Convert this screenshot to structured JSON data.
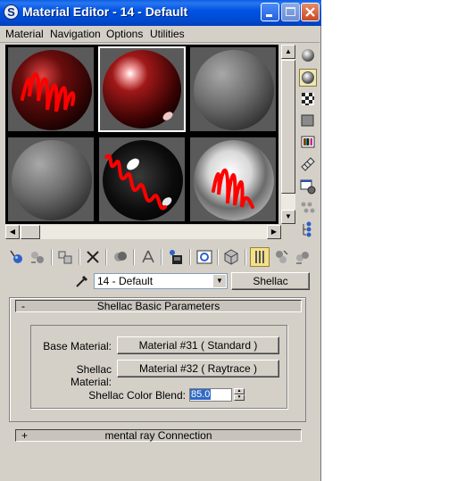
{
  "window": {
    "title": "Material Editor - 14 - Default",
    "app_icon": "3ds-max-icon"
  },
  "menubar": [
    "Material",
    "Navigation",
    "Options",
    "Utilities"
  ],
  "sample_slots": [
    {
      "label": "slot-1",
      "sphere": "dark-red",
      "scribble": true,
      "active": false
    },
    {
      "label": "slot-2",
      "sphere": "red-glossy",
      "scribble": false,
      "active": true
    },
    {
      "label": "slot-3",
      "sphere": "gray",
      "scribble": false,
      "active": false
    },
    {
      "label": "slot-4",
      "sphere": "gray",
      "scribble": false,
      "active": false
    },
    {
      "label": "slot-5",
      "sphere": "black-glossy",
      "scribble": true,
      "active": false
    },
    {
      "label": "slot-6",
      "sphere": "chrome",
      "scribble": true,
      "active": false
    }
  ],
  "name_row": {
    "material_name": "14 - Default",
    "type_button": "Shellac"
  },
  "rollouts": {
    "basic": {
      "sign": "-",
      "title": "Shellac Basic Parameters"
    },
    "mental_ray": {
      "sign": "+",
      "title": "mental ray Connection"
    }
  },
  "params": {
    "base_label": "Base Material:",
    "base_value": "Material #31  ( Standard )",
    "shellac_label": "Shellac Material:",
    "shellac_value": "Material #32  ( Raytrace )",
    "blend_label": "Shellac Color Blend:",
    "blend_value": "85.0"
  },
  "colors": {
    "titlebar": "#0054e3",
    "panel": "#d4d0c8",
    "scribble": "#ff0000"
  }
}
